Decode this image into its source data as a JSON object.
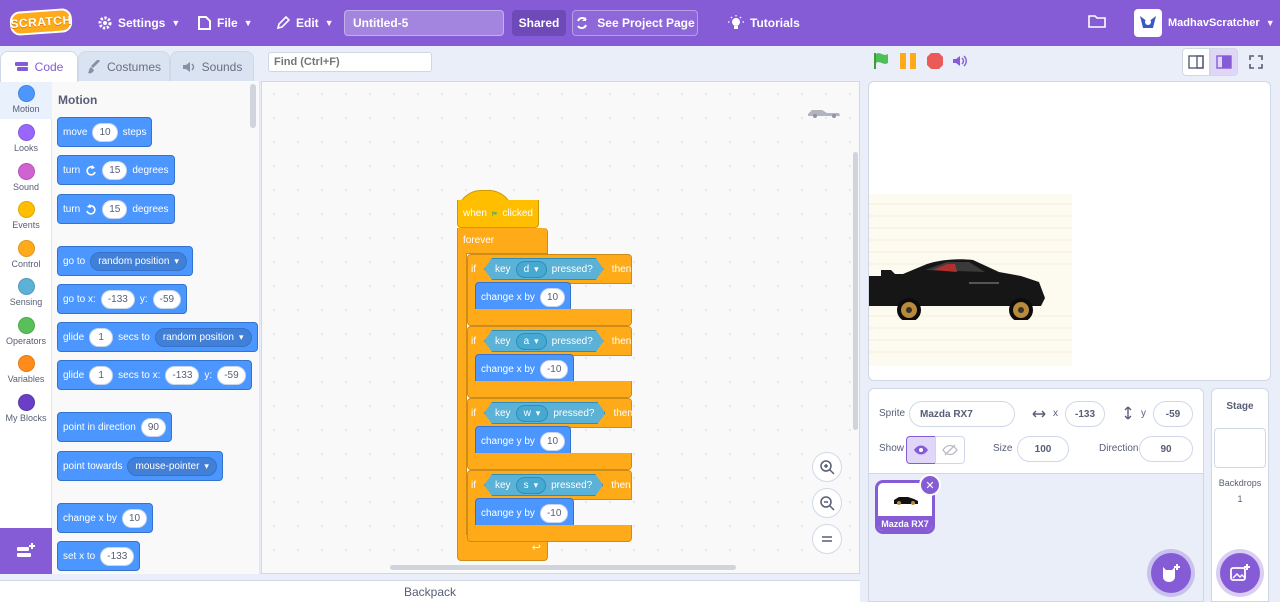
{
  "menubar": {
    "logo": "SCRATCH",
    "settings": "Settings",
    "file": "File",
    "edit": "Edit",
    "project_title": "Untitled-5",
    "shared": "Shared",
    "see_project": "See Project Page",
    "tutorials": "Tutorials",
    "username": "MadhavScratcher"
  },
  "tabs": {
    "code": "Code",
    "costumes": "Costumes",
    "sounds": "Sounds"
  },
  "categories": [
    {
      "label": "Motion",
      "color": "#4c97ff"
    },
    {
      "label": "Looks",
      "color": "#9966ff"
    },
    {
      "label": "Sound",
      "color": "#cf63cf"
    },
    {
      "label": "Events",
      "color": "#ffbf00"
    },
    {
      "label": "Control",
      "color": "#ffab19"
    },
    {
      "label": "Sensing",
      "color": "#5cb1d6"
    },
    {
      "label": "Operators",
      "color": "#59c059"
    },
    {
      "label": "Variables",
      "color": "#ff8c1a"
    },
    {
      "label": "My Blocks",
      "color": "#6a3fc6"
    }
  ],
  "palette": {
    "title": "Motion",
    "move": {
      "a": "move",
      "v": "10",
      "b": "steps"
    },
    "turn_right": {
      "a": "turn",
      "v": "15",
      "b": "degrees"
    },
    "turn_left": {
      "a": "turn",
      "v": "15",
      "b": "degrees"
    },
    "goto": {
      "a": "go to",
      "opt": "random position"
    },
    "goto_xy": {
      "a": "go to x:",
      "x": "-133",
      "b": "y:",
      "y": "-59"
    },
    "glide": {
      "a": "glide",
      "v": "1",
      "b": "secs to",
      "opt": "random position"
    },
    "glide_xy": {
      "a": "glide",
      "v": "1",
      "b": "secs to x:",
      "x": "-133",
      "c": "y:",
      "y": "-59"
    },
    "point_dir": {
      "a": "point in direction",
      "v": "90"
    },
    "point_towards": {
      "a": "point towards",
      "opt": "mouse-pointer"
    },
    "change_x": {
      "a": "change x by",
      "v": "10"
    },
    "set_x": {
      "a": "set x to",
      "v": "-133"
    }
  },
  "find": {
    "placeholder": "Find (Ctrl+F)"
  },
  "script": {
    "hat_when": "when",
    "hat_clicked": "clicked",
    "forever": "forever",
    "if_label": "if",
    "then_label": "then",
    "key_label": "key",
    "pressed_label": "pressed?",
    "ifs": [
      {
        "key": "d",
        "action": "change x by",
        "value": "10"
      },
      {
        "key": "a",
        "action": "change x by",
        "value": "-10"
      },
      {
        "key": "w",
        "action": "change y by",
        "value": "10"
      },
      {
        "key": "s",
        "action": "change y by",
        "value": "-10"
      }
    ]
  },
  "backpack": "Backpack",
  "sprite_info": {
    "sprite_label": "Sprite",
    "sprite_name": "Mazda RX7",
    "x_label": "x",
    "x": "-133",
    "y_label": "y",
    "y": "-59",
    "show_label": "Show",
    "size_label": "Size",
    "size": "100",
    "direction_label": "Direction",
    "direction": "90"
  },
  "sprite_list": [
    {
      "name": "Mazda RX7",
      "selected": true
    }
  ],
  "stage_pane": {
    "title": "Stage",
    "backdrops_label": "Backdrops",
    "backdrops_count": "1"
  },
  "colors": {
    "accent": "#855cd6",
    "motion": "#4c97ff",
    "events": "#ffbf00",
    "control": "#ffab19",
    "sensing": "#5cb1d6",
    "green_flag": "#4cbf56",
    "stop": "#ec5959"
  }
}
